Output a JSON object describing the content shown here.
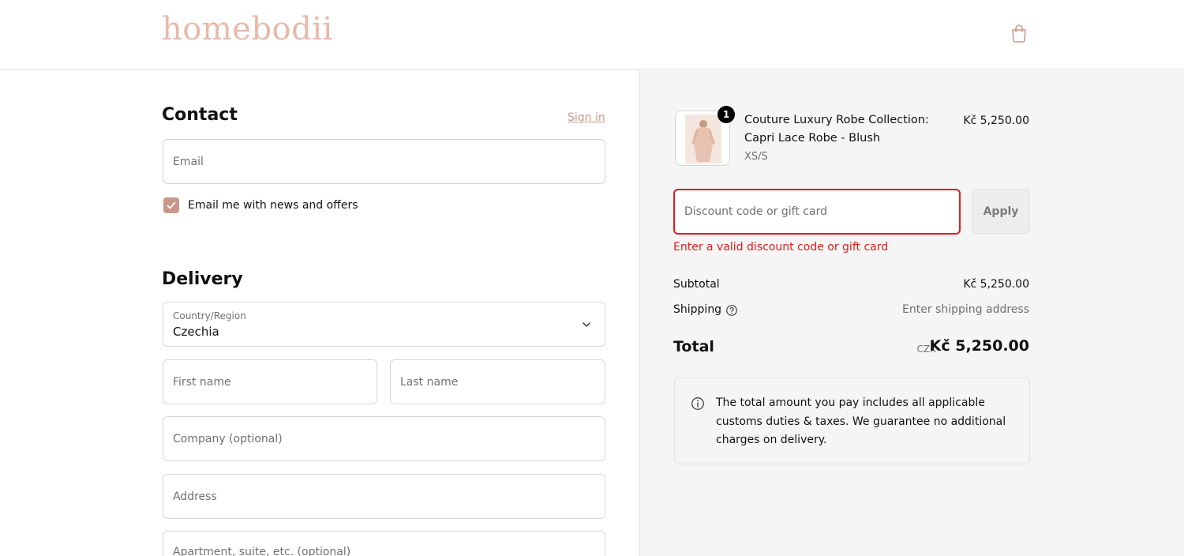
{
  "header": {
    "logo_text": "homebodii",
    "cart_icon": "shopping-bag-icon"
  },
  "contact": {
    "title": "Contact",
    "sign_in": "Sign in",
    "email_placeholder": "Email",
    "newsletter_label": "Email me with news and offers",
    "newsletter_checked": true
  },
  "delivery": {
    "title": "Delivery",
    "country_label": "Country/Region",
    "country_value": "Czechia",
    "first_name_placeholder": "First name",
    "last_name_placeholder": "Last name",
    "company_placeholder": "Company (optional)",
    "address_placeholder": "Address",
    "apartment_placeholder": "Apartment, suite, etc. (optional)"
  },
  "summary": {
    "product": {
      "quantity": "1",
      "name": "Couture Luxury Robe Collection: Capri Lace Robe - Blush",
      "variant": "XS/S",
      "price": "Kč 5,250.00"
    },
    "discount_placeholder": "Discount code or gift card",
    "apply_label": "Apply",
    "discount_error": "Enter a valid discount code or gift card",
    "subtotal_label": "Subtotal",
    "subtotal_value": "Kč 5,250.00",
    "shipping_label": "Shipping",
    "shipping_value": "Enter shipping address",
    "total_label": "Total",
    "total_currency": "CZK",
    "total_value": "Kč 5,250.00",
    "notice_text": "The total amount you pay includes all applicable customs duties & taxes. We guarantee no additional charges on delivery."
  },
  "colors": {
    "brand": "#e8b9a8",
    "accent": "#c9968a",
    "error": "#dd1d1d"
  }
}
